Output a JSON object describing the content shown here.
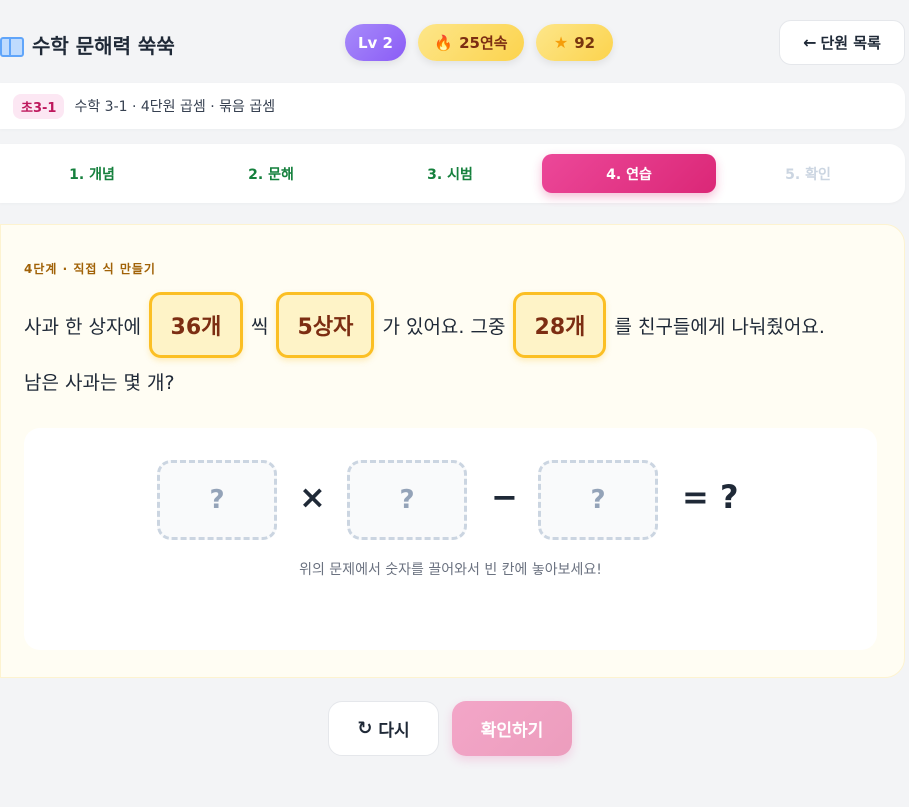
{
  "header": {
    "app_title": "수학 문해력 쑥쑥",
    "level": "Lv 2",
    "streak": "25연속",
    "stars": "92",
    "back_button": "단원 목록"
  },
  "breadcrumb": {
    "grade": "초3-1",
    "path": "수학 3-1 · 4단원 곱셈 · 묶음 곱셈"
  },
  "steps": [
    {
      "label": "1. 개념",
      "state": "done"
    },
    {
      "label": "2. 문해",
      "state": "done"
    },
    {
      "label": "3. 시범",
      "state": "done"
    },
    {
      "label": "4. 연습",
      "state": "active"
    },
    {
      "label": "5. 확인",
      "state": "locked"
    }
  ],
  "problem": {
    "stage_label": "4단계 · 직접 식 만들기",
    "part1": "사과 한 상자에",
    "num1": "36개",
    "part2": "씩",
    "num2": "5상자",
    "part3": "가 있어요. 그중",
    "num3": "28개",
    "part4": "를 친구들에게 나눠줬어요.",
    "line2": "남은 사과는 몇 개?"
  },
  "equation": {
    "slot1": "?",
    "op1": "×",
    "slot2": "?",
    "op2": "−",
    "slot3": "?",
    "result": "= ?",
    "hint": "위의 문제에서 숫자를 끌어와서 빈 칸에 놓아보세요!"
  },
  "actions": {
    "retry": "다시",
    "confirm": "확인하기"
  },
  "colors": {
    "accent": "#db2777",
    "done_step": "#15803d",
    "chip_border": "#fbbf24"
  }
}
